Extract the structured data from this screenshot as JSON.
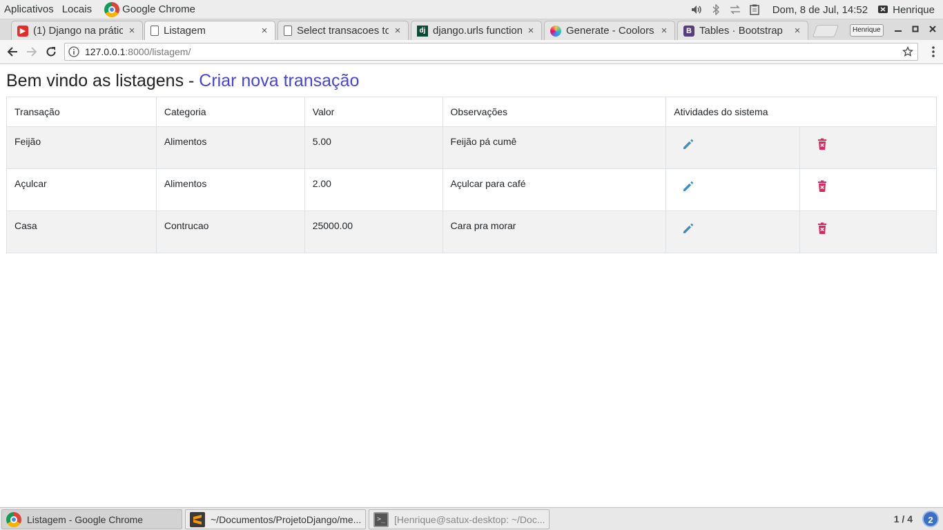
{
  "top_panel": {
    "applications": "Aplicativos",
    "places": "Locais",
    "app_name": "Google Chrome",
    "clock": "Dom,  8 de Jul, 14:52",
    "user": "Henrique",
    "icons": [
      "volume-icon",
      "bluetooth-icon",
      "network-icon",
      "clipboard-icon"
    ]
  },
  "tabs": [
    {
      "title": "(1) Django na prátic",
      "favicon": "youtube-icon",
      "active": false
    },
    {
      "title": "Listagem",
      "favicon": "document-icon",
      "active": true
    },
    {
      "title": "Select transacoes to",
      "favicon": "document-icon",
      "active": false
    },
    {
      "title": "django.urls functions",
      "favicon": "django-icon",
      "active": false
    },
    {
      "title": "Generate - Coolors.c",
      "favicon": "coolors-icon",
      "active": false
    },
    {
      "title": "Tables · Bootstrap",
      "favicon": "bootstrap-icon",
      "active": false
    }
  ],
  "tab_close_glyph": "×",
  "profile_chip": "Henrique",
  "address_bar": {
    "host": "127.0.0.1",
    "path": ":8000/listagem/"
  },
  "page": {
    "heading_prefix": "Bem vindo as listagens - ",
    "heading_link": "Criar nova transação",
    "table": {
      "headers": [
        "Transação",
        "Categoria",
        "Valor",
        "Observações",
        "Atividades do sistema"
      ],
      "rows": [
        {
          "transacao": "Feijão",
          "categoria": "Alimentos",
          "valor": "5.00",
          "observacoes": "Feijão pá cumê"
        },
        {
          "transacao": "Açulcar",
          "categoria": "Alimentos",
          "valor": "2.00",
          "observacoes": "Açulcar para café"
        },
        {
          "transacao": "Casa",
          "categoria": "Contrucao",
          "valor": "25000.00",
          "observacoes": "Cara pra morar"
        }
      ],
      "action_icons": [
        "pencil-icon",
        "trash-icon"
      ],
      "colors": {
        "edit": "#3d8fc0",
        "delete": "#e0245e"
      }
    }
  },
  "taskbar": {
    "items": [
      {
        "label": "Listagem - Google Chrome",
        "active": true
      },
      {
        "label": "~/Documentos/ProjetoDjango/me...",
        "active": false
      },
      {
        "label": "[Henrique@satux-desktop: ~/Doc...",
        "active": false
      }
    ],
    "workspace": "1 / 4",
    "notifications": "2"
  }
}
